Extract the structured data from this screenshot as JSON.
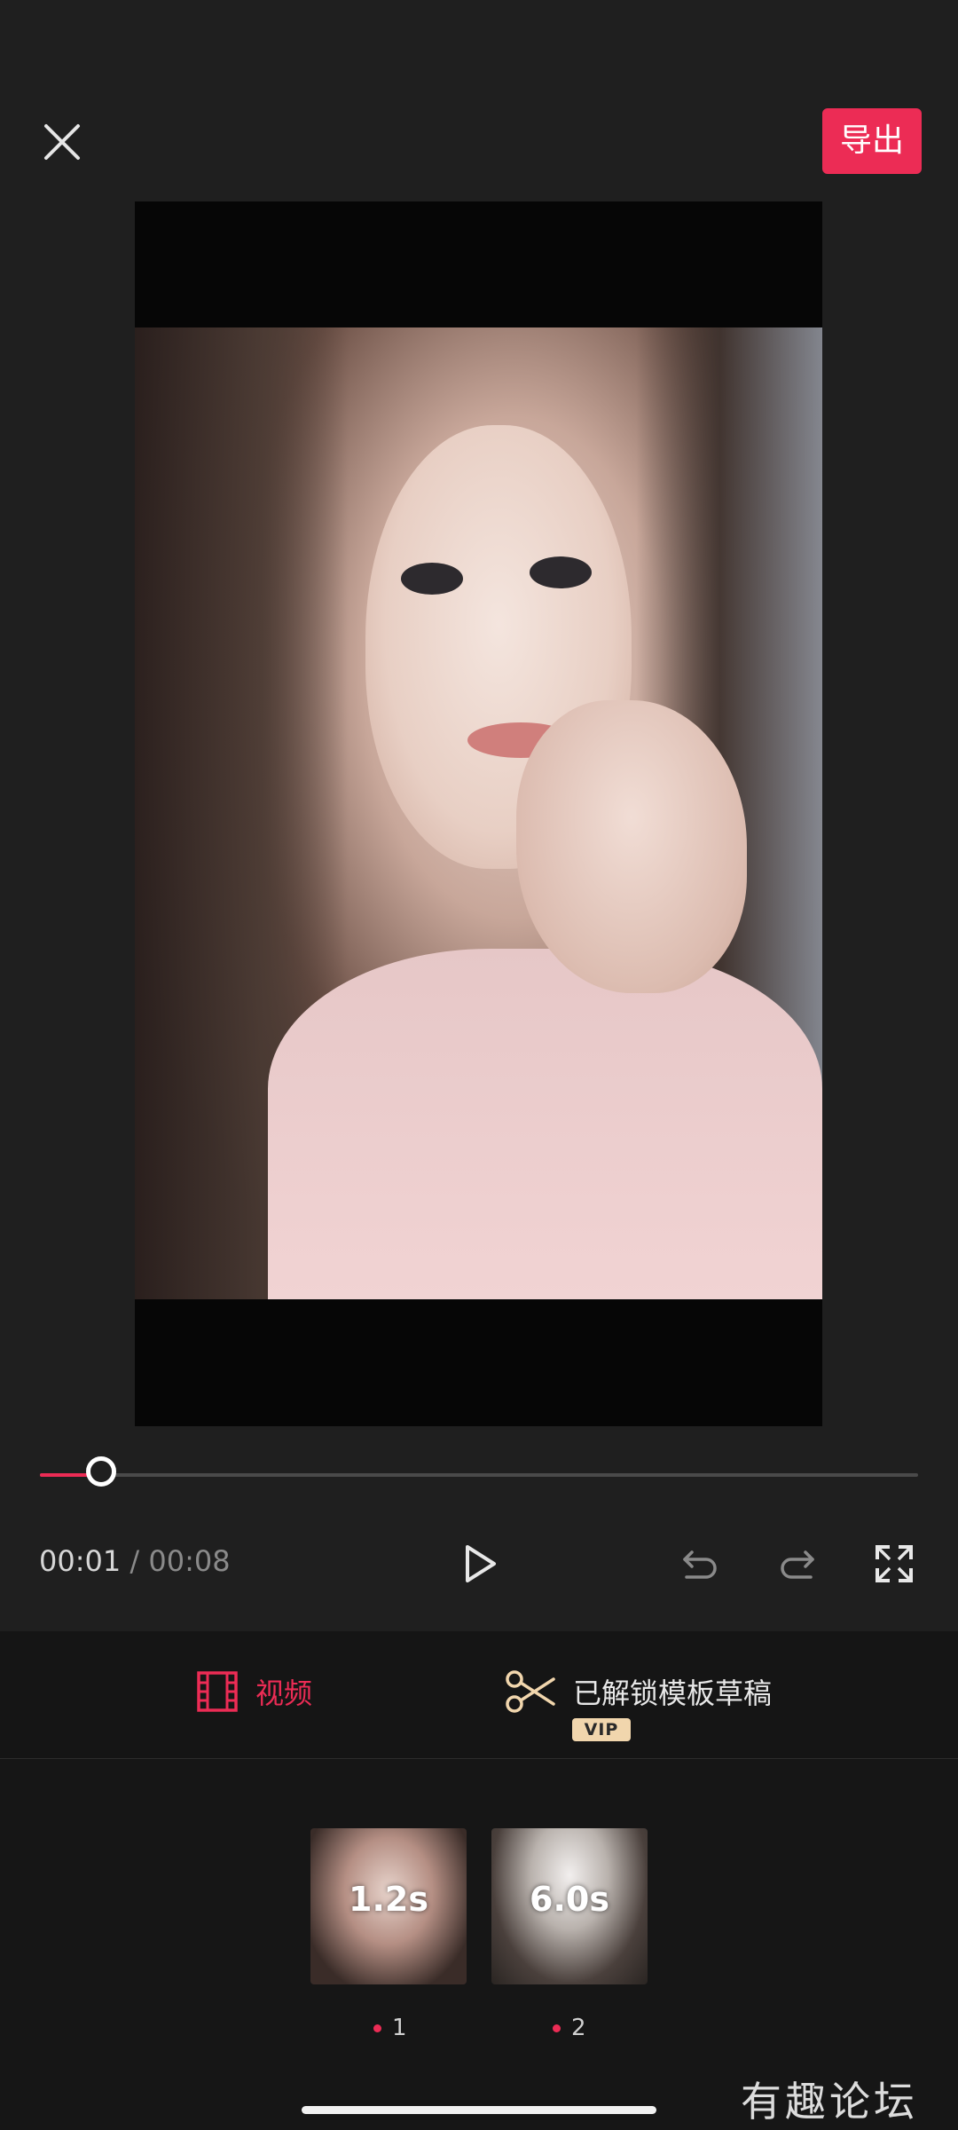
{
  "header": {
    "export_label": "导出"
  },
  "player": {
    "current_time": "00:01",
    "separator": "/",
    "total_time": "00:08",
    "progress": 0.07
  },
  "tabs": {
    "video_label": "视频",
    "template_label": "已解锁模板草稿",
    "vip_badge": "VIP"
  },
  "clips": [
    {
      "duration": "1.2s",
      "index": "1"
    },
    {
      "duration": "6.0s",
      "index": "2"
    }
  ],
  "watermark": "有趣论坛",
  "colors": {
    "accent": "#ec2c55",
    "background": "#1f1f1f",
    "vip": "#f1d6ad"
  },
  "icons": [
    "close-icon",
    "play-icon",
    "undo-icon",
    "redo-icon",
    "fullscreen-icon",
    "film-icon",
    "scissors-icon"
  ]
}
